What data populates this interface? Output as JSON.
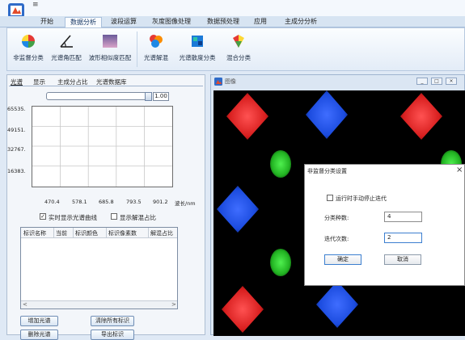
{
  "titlebar": {
    "quick_access_mark": "≡"
  },
  "tabs": [
    {
      "label": "开始",
      "active": false
    },
    {
      "label": "数据分析",
      "active": true
    },
    {
      "label": "波段运算",
      "active": false
    },
    {
      "label": "灰度图像处理",
      "active": false
    },
    {
      "label": "数据预处理",
      "active": false
    },
    {
      "label": "应用",
      "active": false
    },
    {
      "label": "主成分分析",
      "active": false
    }
  ],
  "ribbon": [
    {
      "label": "非监督分类",
      "icon": "pie-chart-icon"
    },
    {
      "label": "光谱角匹配",
      "icon": "angle-icon"
    },
    {
      "label": "波形相似度匹配",
      "icon": "waveform-icon"
    },
    {
      "label": "光谱解混",
      "icon": "color-balls-icon"
    },
    {
      "label": "光谱散度分类",
      "icon": "cube-icon"
    },
    {
      "label": "混合分类",
      "icon": "mixed-palette-icon"
    }
  ],
  "left_panel": {
    "tabs": [
      "光谱",
      "显示",
      "主成分占比",
      "光谱数据库"
    ],
    "slider_value": "1.00",
    "plot": {
      "y_ticks": [
        "65535.",
        "49151.",
        "32767.",
        "16383."
      ],
      "x_ticks": [
        "470.4",
        "578.1",
        "685.8",
        "793.5",
        "901.2"
      ],
      "x_unit": "波长/nm"
    },
    "checkboxes": [
      {
        "label": "实时显示光谱曲线",
        "checked": true,
        "mark": "✓"
      },
      {
        "label": "显示解混占比",
        "checked": false,
        "mark": ""
      }
    ],
    "table_headers": [
      "标识名称",
      "当前",
      "标识颜色",
      "标识像素数",
      "解混占比"
    ],
    "scroll_left": "<",
    "scroll_right": ">",
    "buttons": [
      "增加光谱",
      "清除所有标识",
      "删除光谱",
      "导出标识"
    ]
  },
  "image_window": {
    "title": "图像",
    "minimize": "_",
    "maximize": "□",
    "close": "×"
  },
  "dialog": {
    "title": "非监督分类设置",
    "close": "×",
    "stop_checkbox": {
      "label": "运行时手动停止迭代",
      "checked": false
    },
    "class_count_label": "分类种数:",
    "class_count_value": "4",
    "iterations_label": "迭代次数:",
    "iterations_value": "2",
    "ok_label": "确定",
    "cancel_label": "取消"
  },
  "colors": {
    "ribbon_accent": "#1a3a66",
    "pattern_red": "#d81f1f",
    "pattern_green": "#22b322",
    "pattern_blue": "#1b4bde",
    "image_background": "#000000"
  }
}
